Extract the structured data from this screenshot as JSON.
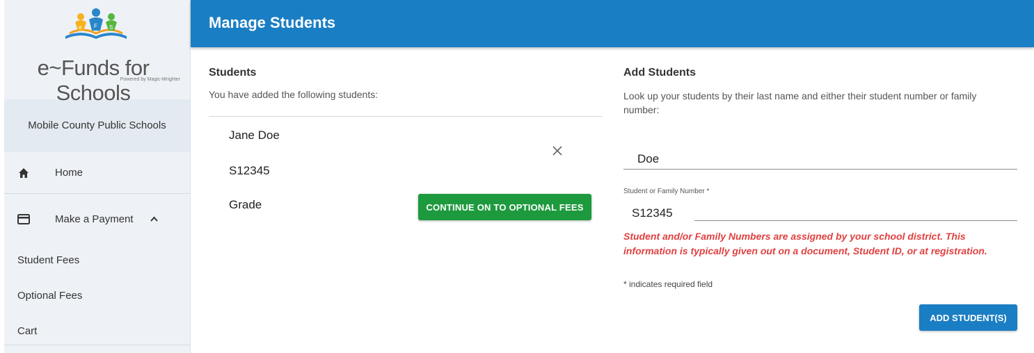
{
  "brand": {
    "name": "e~Funds for Schools",
    "tagline": "Powered by Magic-Wrighter",
    "logo_letters": [
      "e",
      "F",
      "S"
    ]
  },
  "sidebar": {
    "district": "Mobile County Public Schools",
    "home_label": "Home",
    "home_icon": "home-icon",
    "payment_label": "Make a Payment",
    "payment_icon": "credit-card-icon",
    "payment_chevron": "^",
    "items": [
      {
        "label": "Student Fees"
      },
      {
        "label": "Optional Fees"
      },
      {
        "label": "Cart"
      }
    ]
  },
  "header": {
    "title": "Manage Students"
  },
  "students": {
    "title": "Students",
    "subtitle": "You have added the following students:",
    "student": {
      "name": "Jane Doe",
      "number": "S12345",
      "grade": "Grade"
    },
    "remove_symbol": "×",
    "continue_label": "CONTINUE ON TO OPTIONAL FEES"
  },
  "add": {
    "title": "Add Students",
    "subtitle": "Look up your students by their last name and either their student number or family number:",
    "last_name_value": "Doe",
    "number_label": "Student or Family Number *",
    "number_value": "S12345",
    "hint": "Student and/or Family Numbers are assigned by your school district. This information is typically given out on a document, Student ID, or at registration.",
    "required_note": "* indicates required field",
    "add_label": "ADD STUDENT(S)"
  },
  "colors": {
    "header": "#1a7ec4",
    "continue": "#1e9a3e",
    "hint": "#e04040",
    "sidebar": "#eef2f6"
  }
}
